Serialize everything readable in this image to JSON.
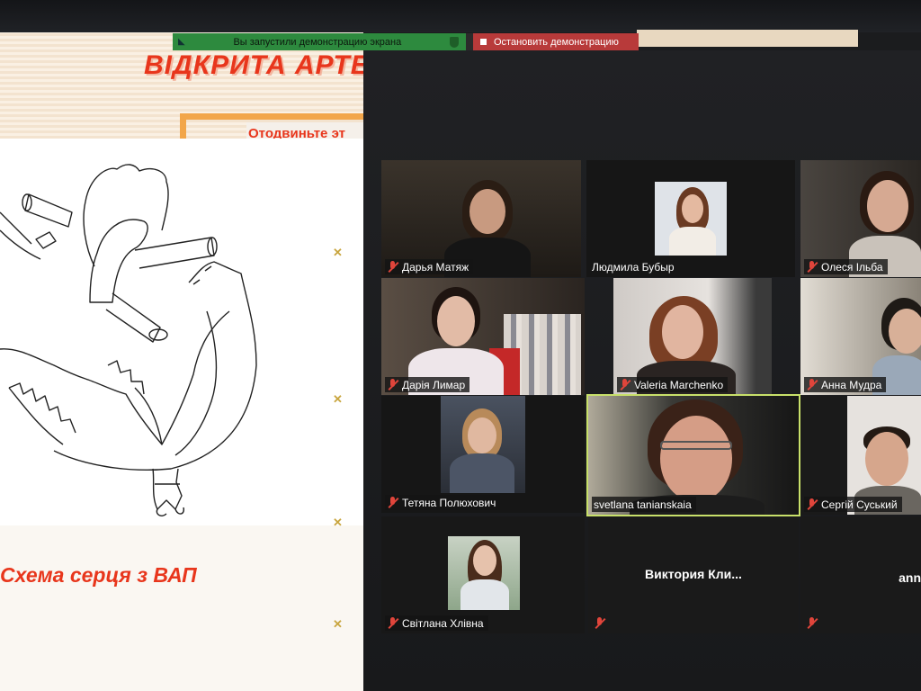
{
  "share_toolbar": {
    "status": "Вы запустили демонстрацию экрана",
    "stop": "Остановить демонстрацию"
  },
  "slide": {
    "title": "ВІДКРИТА АРТЕ",
    "button": "Отодвиньте эт",
    "caption": "Схема серця  з ВАП"
  },
  "participants": [
    {
      "name": "Дарья Матяж",
      "muted": true
    },
    {
      "name": "Людмила Бубыр",
      "muted": false
    },
    {
      "name": "Олеся Ільба",
      "muted": true
    },
    {
      "name": "Дарія Лимар",
      "muted": true
    },
    {
      "name": "Valeria Marchenko",
      "muted": true
    },
    {
      "name": "Анна Мудра",
      "muted": true
    },
    {
      "name": "Тетяна Полюхович",
      "muted": true
    },
    {
      "name": "svetlana tanianskaia",
      "muted": false,
      "speaking": true
    },
    {
      "name": "Сергій Суський",
      "muted": true
    },
    {
      "name": "Світлана Хлівна",
      "muted": true
    },
    {
      "name": "Виктория  Кли...",
      "muted": true,
      "video": false
    },
    {
      "name": "ann",
      "muted": true,
      "video": false
    }
  ],
  "colors": {
    "accent_red": "#e8361c",
    "share_green": "#2d8a3e",
    "stop_red": "#b83a3a",
    "speaker_outline": "#c8e06a"
  },
  "icons": {
    "muted": "mic-muted-icon",
    "shield": "shield-icon",
    "stop": "stop-square-icon",
    "close": "x-icon"
  }
}
